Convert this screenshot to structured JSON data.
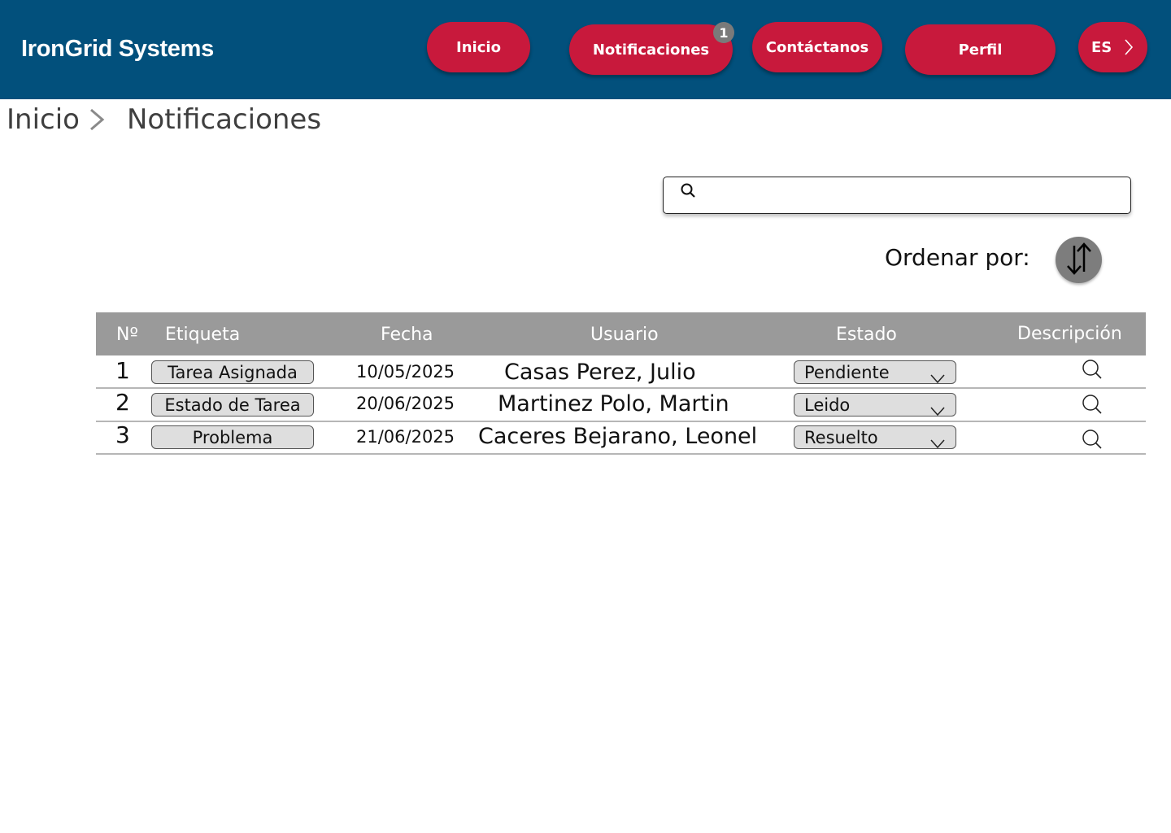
{
  "header": {
    "brand": "IronGrid Systems",
    "nav": {
      "inicio": "Inicio",
      "notificaciones": "Notificaciones",
      "notificaciones_badge": "1",
      "contactanos": "Contáctanos",
      "perfil": "Perfil",
      "language": "ES"
    }
  },
  "breadcrumb": {
    "home": "Inicio",
    "current": "Notificaciones"
  },
  "search": {
    "value": "",
    "placeholder": ""
  },
  "sort": {
    "label": "Ordenar por:"
  },
  "table": {
    "columns": [
      "Nº",
      "Etiqueta",
      "Fecha",
      "Usuario",
      "Estado",
      "Descripción"
    ],
    "rows": [
      {
        "num": "1",
        "etiqueta": "Tarea Asignada",
        "fecha": "10/05/2025",
        "usuario": "Casas Perez, Julio",
        "estado": "Pendiente"
      },
      {
        "num": "2",
        "etiqueta": "Estado de Tarea",
        "fecha": "20/06/2025",
        "usuario": "Martinez Polo, Martin",
        "estado": "Leido"
      },
      {
        "num": "3",
        "etiqueta": "Problema",
        "fecha": "21/06/2025",
        "usuario": "Caceres Bejarano, Leonel",
        "estado": "Resuelto"
      }
    ]
  },
  "colors": {
    "header_bg": "#02507c",
    "nav_button": "#c8193c",
    "table_header": "#9a9a9a",
    "badge": "#7a7a7a"
  },
  "icons": {
    "search": "search-icon",
    "sort": "sort-arrows-icon",
    "lang_chevron": "chevron-right-icon",
    "breadcrumb_separator": "chevron-right-icon",
    "status_caret": "chevron-down-icon",
    "description": "magnifier-icon"
  }
}
